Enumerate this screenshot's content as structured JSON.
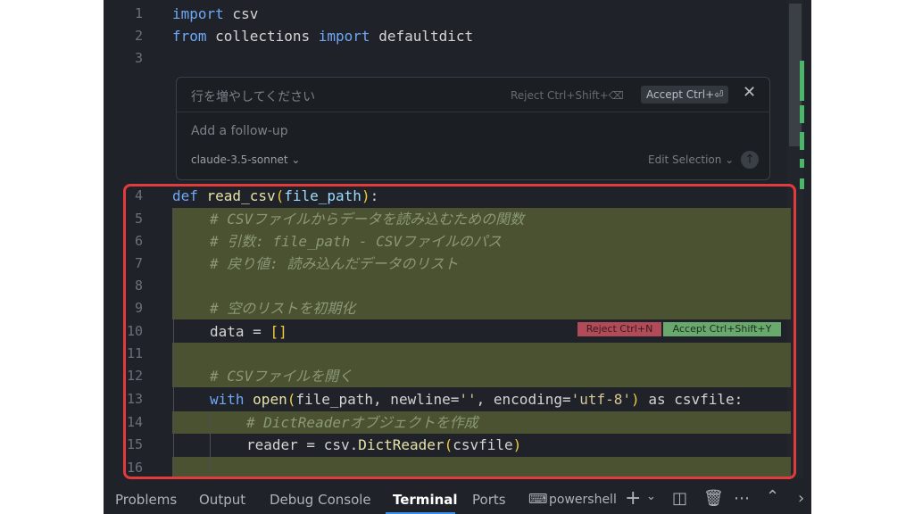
{
  "editor": {
    "lines": [
      {
        "n": "1",
        "code": "import csv"
      },
      {
        "n": "2",
        "code": "from collections import defaultdict"
      },
      {
        "n": "3",
        "code": ""
      }
    ]
  },
  "inline_prompt": {
    "prompt": "行を増やしてください",
    "reject_label": "Reject Ctrl+Shift+⌫",
    "accept_label": "Accept Ctrl+⏎",
    "close_icon": "✕",
    "followup_placeholder": "Add a follow-up",
    "model": "claude-3.5-sonnet ⌄",
    "edit_selection": "Edit Selection ⌄"
  },
  "diff": {
    "lines": [
      {
        "n": "4"
      },
      {
        "n": "5"
      },
      {
        "n": "6"
      },
      {
        "n": "7"
      },
      {
        "n": "8"
      },
      {
        "n": "9"
      },
      {
        "n": "10"
      },
      {
        "n": "11"
      },
      {
        "n": "12"
      },
      {
        "n": "13"
      },
      {
        "n": "14"
      },
      {
        "n": "15"
      },
      {
        "n": "16"
      }
    ],
    "code": {
      "l4_def": "def ",
      "l4_fn": "read_csv",
      "l4_param": "file_path",
      "l5": "# CSVファイルからデータを読み込むための関数",
      "l6": "# 引数: file_path - CSVファイルのパス",
      "l7": "# 戻り値: 読み込んだデータのリスト",
      "l9": "# 空のリストを初期化",
      "l10": "data = ",
      "l12": "# CSVファイルを開く",
      "l13_with": "with ",
      "l13_open": "open",
      "l13_args": "file_path, newline=",
      "l13_str1": "''",
      "l13_enc": ", encoding=",
      "l13_str2": "'utf-8'",
      "l13_as": " as csvfile:",
      "l14": "# DictReaderオブジェクトを作成",
      "l15_a": "reader = csv.",
      "l15_fn": "DictReader",
      "l15_arg": "csvfile"
    },
    "inline_reject": "Reject Ctrl+N",
    "inline_accept": "Accept Ctrl+Shift+Y"
  },
  "panel": {
    "tabs": [
      "Problems",
      "Output",
      "Debug Console",
      "Terminal",
      "Ports"
    ],
    "active_tab": "Terminal",
    "shell": "powershell",
    "icons": [
      "terminal-icon",
      "plus-icon",
      "chevron-down-icon",
      "split-icon",
      "trash-icon",
      "more-icon",
      "chevron-up-icon",
      "chevron-right-icon"
    ]
  }
}
